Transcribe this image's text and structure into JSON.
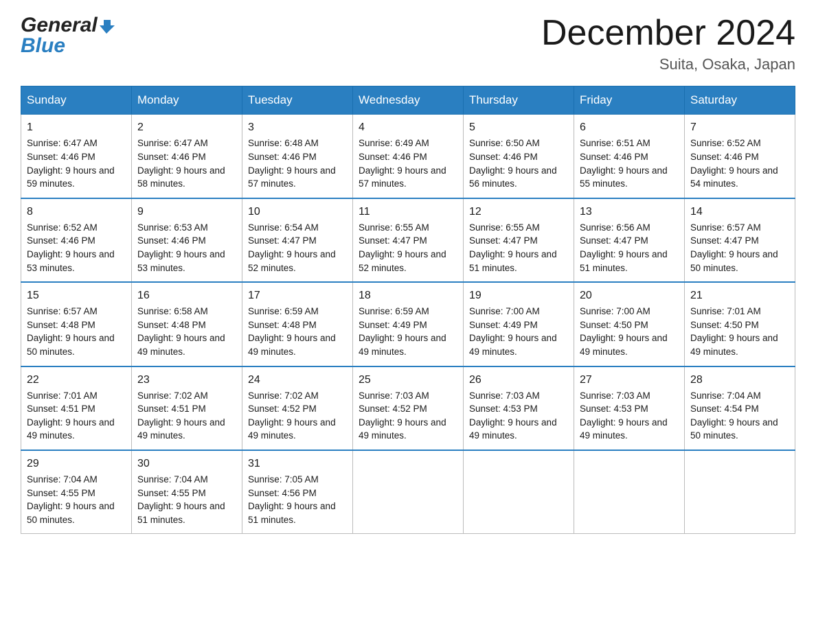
{
  "logo": {
    "general": "General",
    "blue": "Blue"
  },
  "title": "December 2024",
  "location": "Suita, Osaka, Japan",
  "days_header": [
    "Sunday",
    "Monday",
    "Tuesday",
    "Wednesday",
    "Thursday",
    "Friday",
    "Saturday"
  ],
  "weeks": [
    [
      {
        "day": "1",
        "sunrise": "6:47 AM",
        "sunset": "4:46 PM",
        "daylight": "9 hours and 59 minutes."
      },
      {
        "day": "2",
        "sunrise": "6:47 AM",
        "sunset": "4:46 PM",
        "daylight": "9 hours and 58 minutes."
      },
      {
        "day": "3",
        "sunrise": "6:48 AM",
        "sunset": "4:46 PM",
        "daylight": "9 hours and 57 minutes."
      },
      {
        "day": "4",
        "sunrise": "6:49 AM",
        "sunset": "4:46 PM",
        "daylight": "9 hours and 57 minutes."
      },
      {
        "day": "5",
        "sunrise": "6:50 AM",
        "sunset": "4:46 PM",
        "daylight": "9 hours and 56 minutes."
      },
      {
        "day": "6",
        "sunrise": "6:51 AM",
        "sunset": "4:46 PM",
        "daylight": "9 hours and 55 minutes."
      },
      {
        "day": "7",
        "sunrise": "6:52 AM",
        "sunset": "4:46 PM",
        "daylight": "9 hours and 54 minutes."
      }
    ],
    [
      {
        "day": "8",
        "sunrise": "6:52 AM",
        "sunset": "4:46 PM",
        "daylight": "9 hours and 53 minutes."
      },
      {
        "day": "9",
        "sunrise": "6:53 AM",
        "sunset": "4:46 PM",
        "daylight": "9 hours and 53 minutes."
      },
      {
        "day": "10",
        "sunrise": "6:54 AM",
        "sunset": "4:47 PM",
        "daylight": "9 hours and 52 minutes."
      },
      {
        "day": "11",
        "sunrise": "6:55 AM",
        "sunset": "4:47 PM",
        "daylight": "9 hours and 52 minutes."
      },
      {
        "day": "12",
        "sunrise": "6:55 AM",
        "sunset": "4:47 PM",
        "daylight": "9 hours and 51 minutes."
      },
      {
        "day": "13",
        "sunrise": "6:56 AM",
        "sunset": "4:47 PM",
        "daylight": "9 hours and 51 minutes."
      },
      {
        "day": "14",
        "sunrise": "6:57 AM",
        "sunset": "4:47 PM",
        "daylight": "9 hours and 50 minutes."
      }
    ],
    [
      {
        "day": "15",
        "sunrise": "6:57 AM",
        "sunset": "4:48 PM",
        "daylight": "9 hours and 50 minutes."
      },
      {
        "day": "16",
        "sunrise": "6:58 AM",
        "sunset": "4:48 PM",
        "daylight": "9 hours and 49 minutes."
      },
      {
        "day": "17",
        "sunrise": "6:59 AM",
        "sunset": "4:48 PM",
        "daylight": "9 hours and 49 minutes."
      },
      {
        "day": "18",
        "sunrise": "6:59 AM",
        "sunset": "4:49 PM",
        "daylight": "9 hours and 49 minutes."
      },
      {
        "day": "19",
        "sunrise": "7:00 AM",
        "sunset": "4:49 PM",
        "daylight": "9 hours and 49 minutes."
      },
      {
        "day": "20",
        "sunrise": "7:00 AM",
        "sunset": "4:50 PM",
        "daylight": "9 hours and 49 minutes."
      },
      {
        "day": "21",
        "sunrise": "7:01 AM",
        "sunset": "4:50 PM",
        "daylight": "9 hours and 49 minutes."
      }
    ],
    [
      {
        "day": "22",
        "sunrise": "7:01 AM",
        "sunset": "4:51 PM",
        "daylight": "9 hours and 49 minutes."
      },
      {
        "day": "23",
        "sunrise": "7:02 AM",
        "sunset": "4:51 PM",
        "daylight": "9 hours and 49 minutes."
      },
      {
        "day": "24",
        "sunrise": "7:02 AM",
        "sunset": "4:52 PM",
        "daylight": "9 hours and 49 minutes."
      },
      {
        "day": "25",
        "sunrise": "7:03 AM",
        "sunset": "4:52 PM",
        "daylight": "9 hours and 49 minutes."
      },
      {
        "day": "26",
        "sunrise": "7:03 AM",
        "sunset": "4:53 PM",
        "daylight": "9 hours and 49 minutes."
      },
      {
        "day": "27",
        "sunrise": "7:03 AM",
        "sunset": "4:53 PM",
        "daylight": "9 hours and 49 minutes."
      },
      {
        "day": "28",
        "sunrise": "7:04 AM",
        "sunset": "4:54 PM",
        "daylight": "9 hours and 50 minutes."
      }
    ],
    [
      {
        "day": "29",
        "sunrise": "7:04 AM",
        "sunset": "4:55 PM",
        "daylight": "9 hours and 50 minutes."
      },
      {
        "day": "30",
        "sunrise": "7:04 AM",
        "sunset": "4:55 PM",
        "daylight": "9 hours and 51 minutes."
      },
      {
        "day": "31",
        "sunrise": "7:05 AM",
        "sunset": "4:56 PM",
        "daylight": "9 hours and 51 minutes."
      },
      null,
      null,
      null,
      null
    ]
  ],
  "labels": {
    "sunrise": "Sunrise: ",
    "sunset": "Sunset: ",
    "daylight": "Daylight: "
  }
}
